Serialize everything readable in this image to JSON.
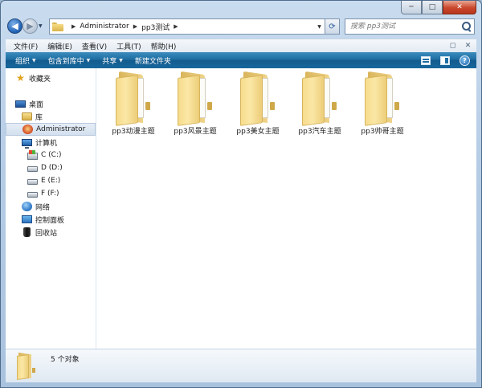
{
  "window": {
    "minimize_glyph": "─",
    "maximize_glyph": "□",
    "close_glyph": "✕"
  },
  "address": {
    "crumbs": [
      "Administrator",
      "pp3测试"
    ],
    "search_placeholder": "搜索 pp3测试"
  },
  "menu": {
    "items": [
      "文件(F)",
      "编辑(E)",
      "查看(V)",
      "工具(T)",
      "帮助(H)"
    ]
  },
  "commands": {
    "items": [
      "组织",
      "包含到库中",
      "共享",
      "新建文件夹"
    ],
    "dropdown_items": [
      0,
      1,
      2
    ],
    "help_glyph": "?"
  },
  "nav_pane": {
    "items": [
      {
        "label": "收藏夹",
        "icon": "favorites-star-icon",
        "indent": 0
      },
      {
        "label": "桌面",
        "icon": "desktop-icon",
        "indent": 0
      },
      {
        "label": "库",
        "icon": "library-icon",
        "indent": 1
      },
      {
        "label": "Administrator",
        "icon": "user-folder-icon",
        "indent": 1,
        "selected": true
      },
      {
        "label": "计算机",
        "icon": "computer-icon",
        "indent": 1
      },
      {
        "label": "C (C:)",
        "icon": "system-drive-icon",
        "indent": 2
      },
      {
        "label": "D (D:)",
        "icon": "drive-icon",
        "indent": 2
      },
      {
        "label": "E (E:)",
        "icon": "drive-icon",
        "indent": 2
      },
      {
        "label": "F (F:)",
        "icon": "drive-icon",
        "indent": 2
      },
      {
        "label": "网络",
        "icon": "network-icon",
        "indent": 1
      },
      {
        "label": "控制面板",
        "icon": "control-panel-icon",
        "indent": 1
      },
      {
        "label": "回收站",
        "icon": "recycle-bin-icon",
        "indent": 1
      }
    ]
  },
  "folders": [
    {
      "name": "pp3动漫主题"
    },
    {
      "name": "pp3风景主题"
    },
    {
      "name": "pp3美女主题"
    },
    {
      "name": "pp3汽车主题"
    },
    {
      "name": "pp3帅哥主题"
    }
  ],
  "details": {
    "status": "5 个对象"
  },
  "colors": {
    "command_bar": "#1f6ea3",
    "window_frame": "#b7cde6",
    "folder_yellow": "#f6dc8c"
  }
}
